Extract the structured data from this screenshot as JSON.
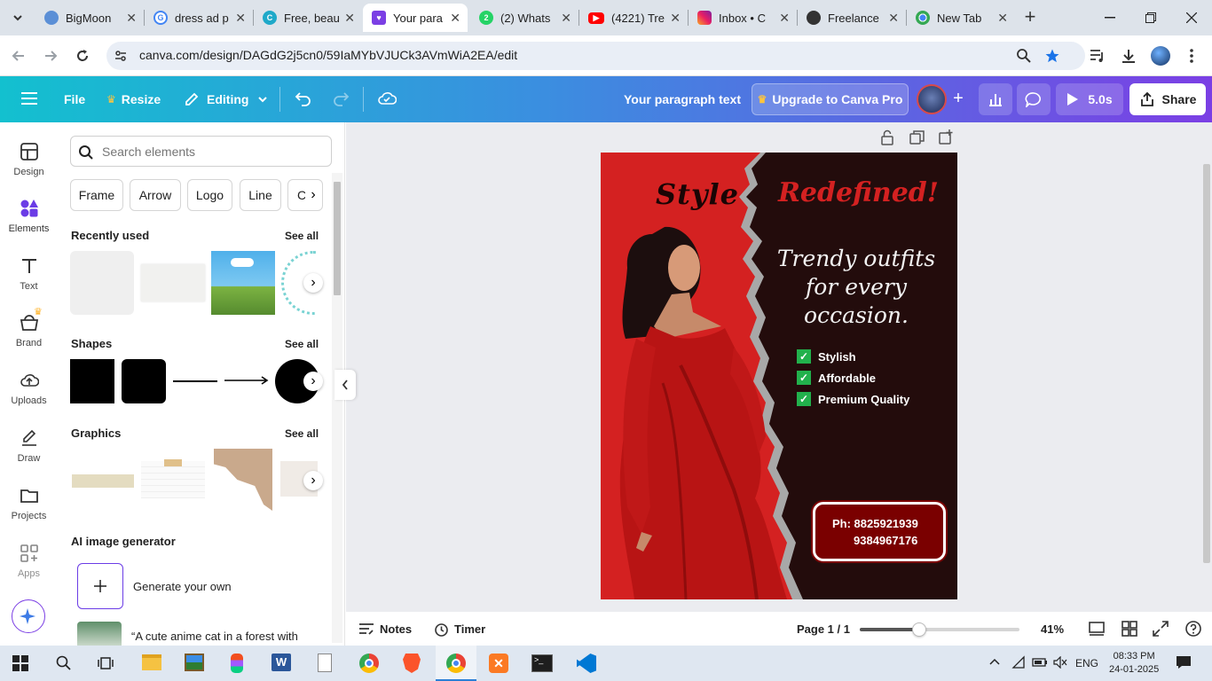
{
  "browser": {
    "tabs": [
      {
        "label": "BigMoon",
        "active": false,
        "icon": "bigmoon-icon"
      },
      {
        "label": "dress ad p",
        "active": false,
        "icon": "google-icon"
      },
      {
        "label": "Free, beau",
        "active": false,
        "icon": "canva-icon"
      },
      {
        "label": "Your para",
        "active": true,
        "icon": "canva-design-icon"
      },
      {
        "label": "(2) Whats",
        "active": false,
        "icon": "whatsapp-icon"
      },
      {
        "label": "(4221) Tre",
        "active": false,
        "icon": "youtube-icon"
      },
      {
        "label": "Inbox • C",
        "active": false,
        "icon": "instagram-icon"
      },
      {
        "label": "Freelance",
        "active": false,
        "icon": "github-icon"
      },
      {
        "label": "New Tab",
        "active": false,
        "icon": "chrome-icon"
      }
    ],
    "url": "canva.com/design/DAGdG2j5cn0/59IaMYbVJUCk3AVmWiA2EA/edit"
  },
  "canva_top": {
    "file": "File",
    "resize": "Resize",
    "editing": "Editing",
    "doc_title": "Your paragraph text",
    "upgrade": "Upgrade to Canva Pro",
    "play_duration": "5.0s",
    "share": "Share"
  },
  "rail": [
    {
      "label": "Design",
      "icon": "design-icon"
    },
    {
      "label": "Elements",
      "icon": "elements-icon"
    },
    {
      "label": "Text",
      "icon": "text-icon"
    },
    {
      "label": "Brand",
      "icon": "brand-icon"
    },
    {
      "label": "Uploads",
      "icon": "uploads-icon"
    },
    {
      "label": "Draw",
      "icon": "draw-icon"
    },
    {
      "label": "Projects",
      "icon": "projects-icon"
    },
    {
      "label": "Apps",
      "icon": "apps-icon"
    }
  ],
  "panel": {
    "search_placeholder": "Search elements",
    "chips": [
      "Frame",
      "Arrow",
      "Logo",
      "Line",
      "Cir"
    ],
    "recently_used": "Recently used",
    "shapes": "Shapes",
    "graphics": "Graphics",
    "see_all": "See all",
    "ai_title": "AI image generator",
    "generate": "Generate your own",
    "prompt_example": "“A cute anime cat in a forest with"
  },
  "design": {
    "headline_left": "Style",
    "headline_right": "Redefined!",
    "tagline_1": "Trendy outfits",
    "tagline_2": "for every",
    "tagline_3": "occasion.",
    "features": [
      "Stylish",
      "Affordable",
      "Premium Quality"
    ],
    "phone_1": "Ph: 8825921939",
    "phone_2": "9384967176",
    "colors": {
      "red": "#d42121",
      "dark": "#230c0c",
      "gray_tear": "#a8a8a8",
      "phone_box": "#7a0000",
      "check_green": "#22b14c"
    }
  },
  "bottom": {
    "notes": "Notes",
    "timer": "Timer",
    "page": "Page 1 / 1",
    "zoom": "41%"
  },
  "taskbar": {
    "lang": "ENG",
    "time": "08:33 PM",
    "date": "24-01-2025"
  }
}
